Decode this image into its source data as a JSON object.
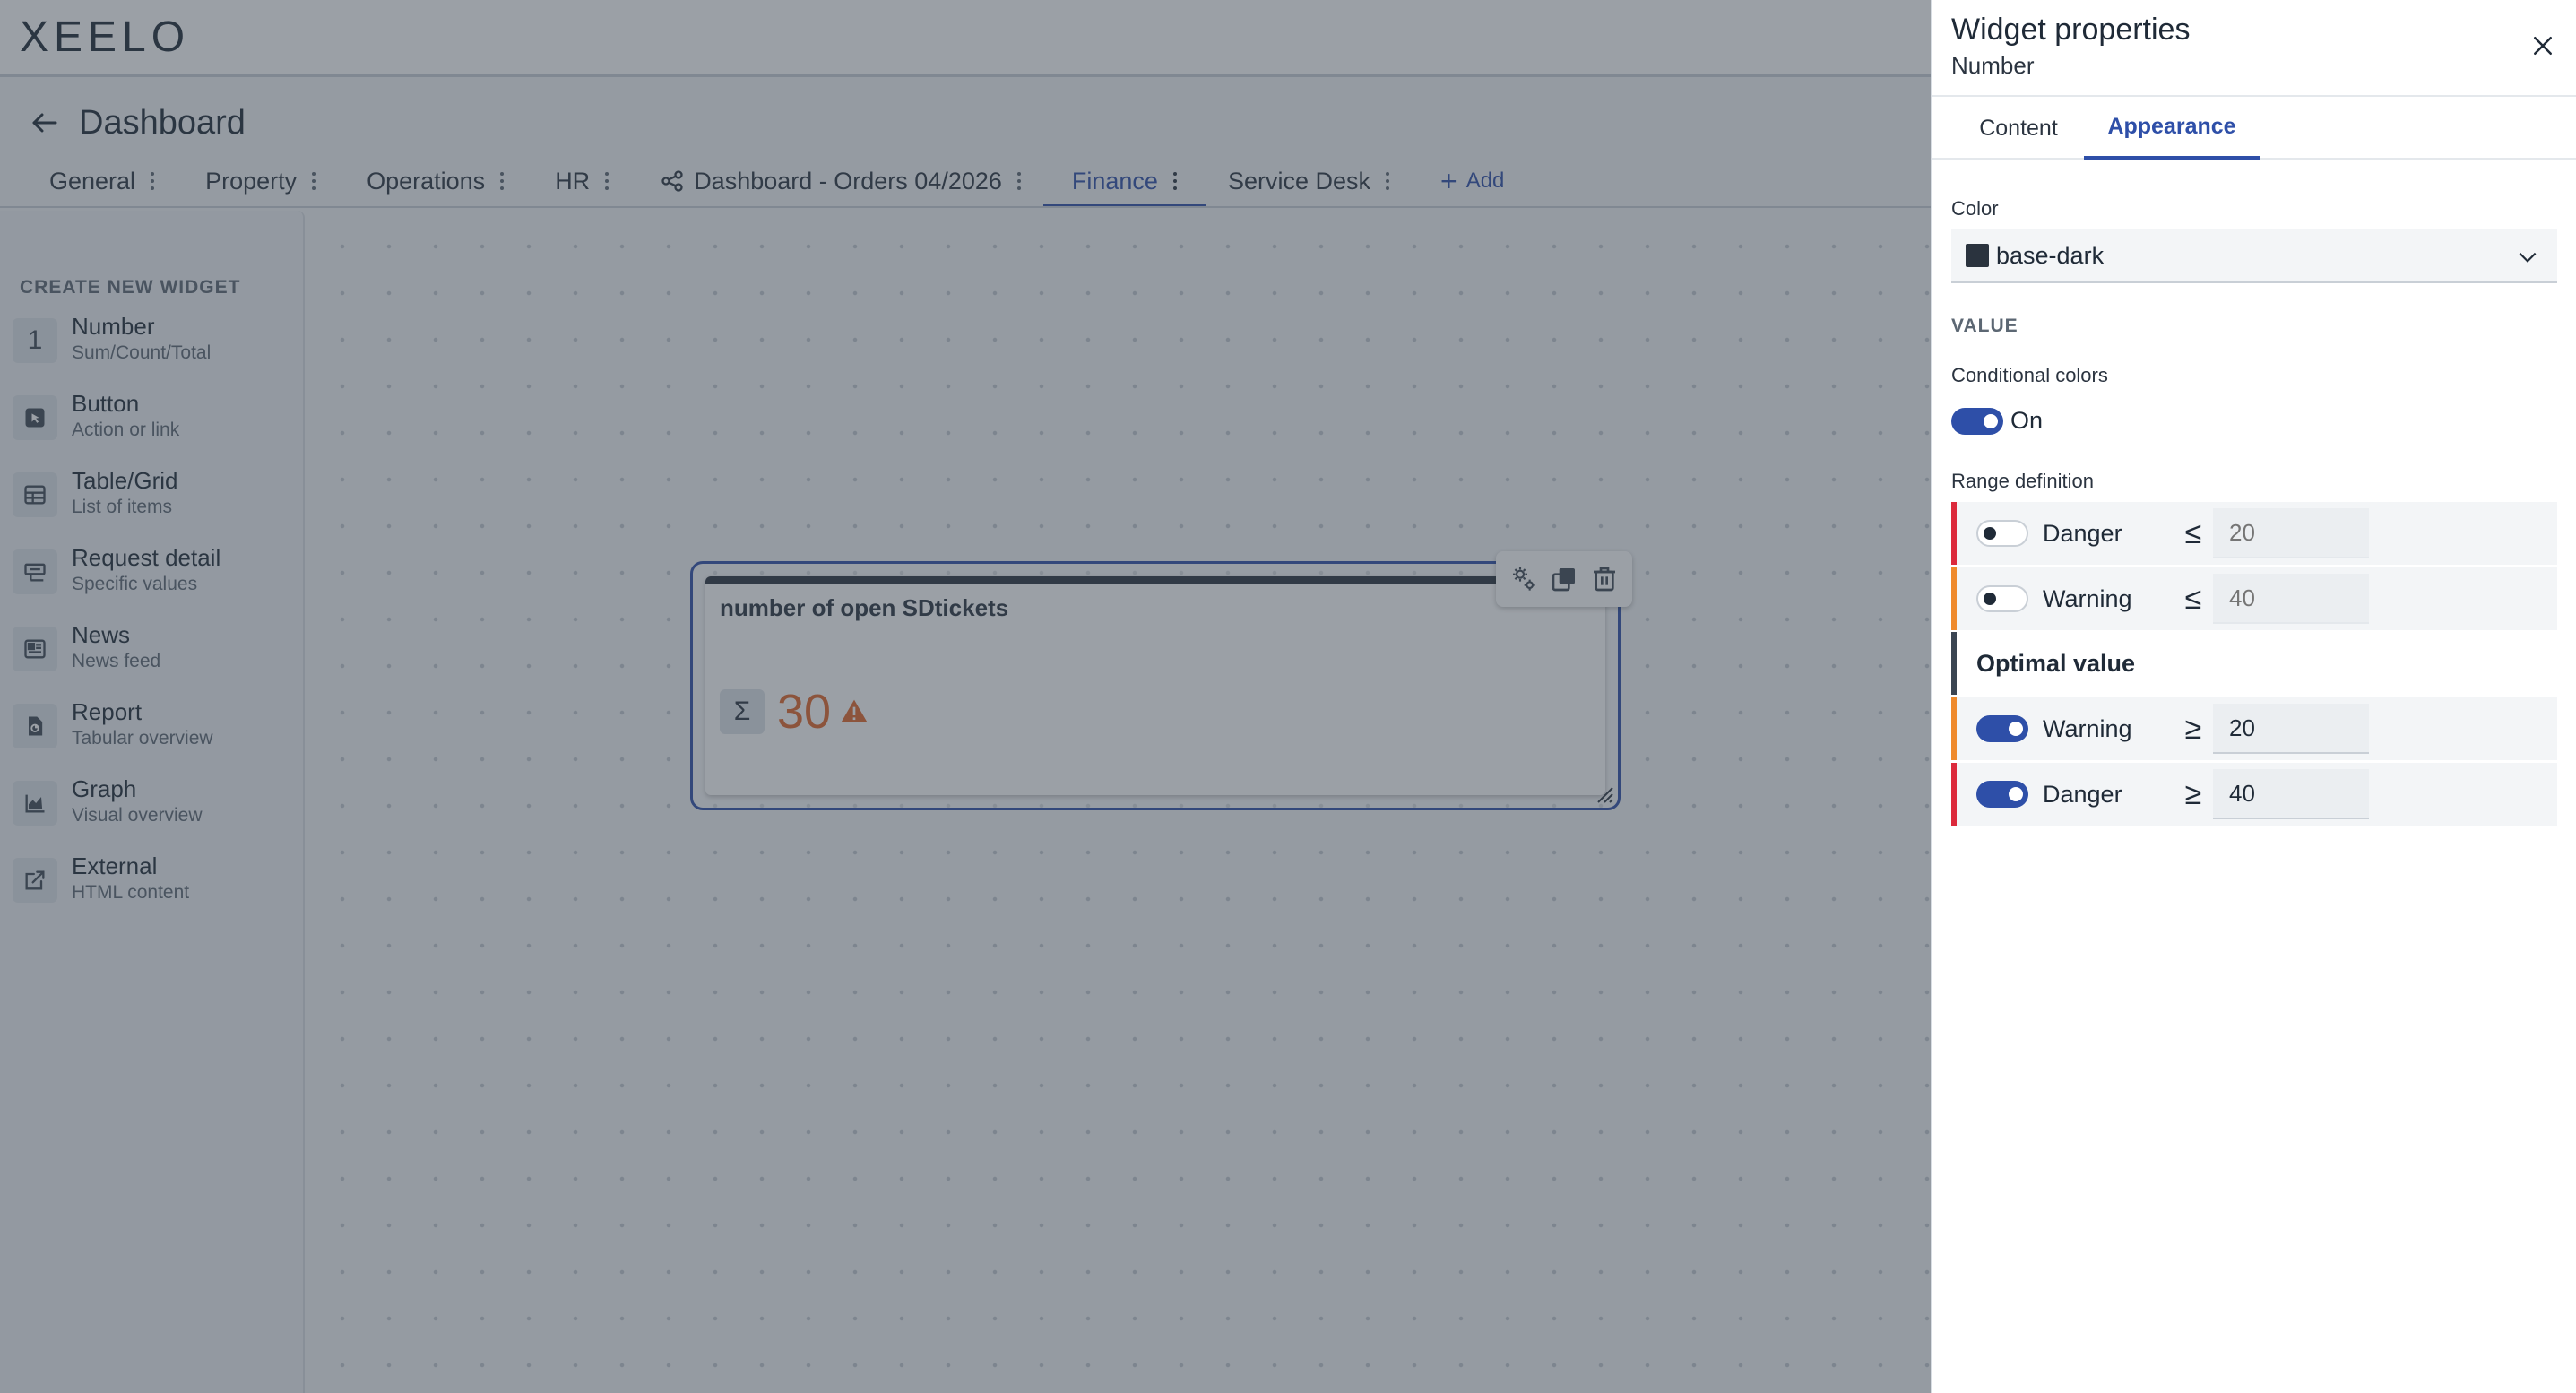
{
  "app": {
    "logo": "XEELO"
  },
  "dashboard": {
    "title": "Dashboard"
  },
  "tabs": [
    {
      "label": "General"
    },
    {
      "label": "Property"
    },
    {
      "label": "Operations"
    },
    {
      "label": "HR"
    },
    {
      "label": "Dashboard - Orders 04/2026",
      "icon": "share-icon"
    },
    {
      "label": "Finance",
      "active": true
    },
    {
      "label": "Service Desk"
    },
    {
      "label": "Add",
      "icon": "plus-icon"
    }
  ],
  "sidebar": {
    "heading": "CREATE NEW WIDGET",
    "items": [
      {
        "name": "Number",
        "sub": "Sum/Count/Total",
        "icon": "number-one-icon",
        "glyph": "1"
      },
      {
        "name": "Button",
        "sub": "Action or link",
        "icon": "button-cursor-icon"
      },
      {
        "name": "Table/Grid",
        "sub": "List of items",
        "icon": "table-icon"
      },
      {
        "name": "Request detail",
        "sub": "Specific values",
        "icon": "request-detail-icon"
      },
      {
        "name": "News",
        "sub": "News feed",
        "icon": "news-icon"
      },
      {
        "name": "Report",
        "sub": "Tabular overview",
        "icon": "report-icon"
      },
      {
        "name": "Graph",
        "sub": "Visual overview",
        "icon": "graph-icon"
      },
      {
        "name": "External",
        "sub": "HTML content",
        "icon": "external-link-icon"
      }
    ]
  },
  "widget": {
    "title": "number of open SDtickets",
    "sigma": "Σ",
    "value": "30",
    "value_color": "#e0662a",
    "status_icon": "warning-triangle-icon"
  },
  "panel": {
    "title": "Widget properties",
    "subtitle": "Number",
    "tabs": {
      "content": "Content",
      "appearance": "Appearance"
    },
    "color": {
      "label": "Color",
      "value": "base-dark",
      "swatch": "#2a333e"
    },
    "value_section": "VALUE",
    "conditional": {
      "label": "Conditional colors",
      "state": "On",
      "enabled": true
    },
    "range": {
      "label": "Range definition",
      "below": [
        {
          "label": "Danger",
          "op": "≤",
          "placeholder": "20",
          "enabled": false,
          "color": "#dc2a3c"
        },
        {
          "label": "Warning",
          "op": "≤",
          "placeholder": "40",
          "enabled": false,
          "color": "#ef8a2c"
        }
      ],
      "optimal": "Optimal value",
      "above": [
        {
          "label": "Warning",
          "op": "≥",
          "value": "20",
          "enabled": true,
          "color": "#ef8a2c"
        },
        {
          "label": "Danger",
          "op": "≥",
          "value": "40",
          "enabled": true,
          "color": "#dc2a3c"
        }
      ]
    }
  }
}
